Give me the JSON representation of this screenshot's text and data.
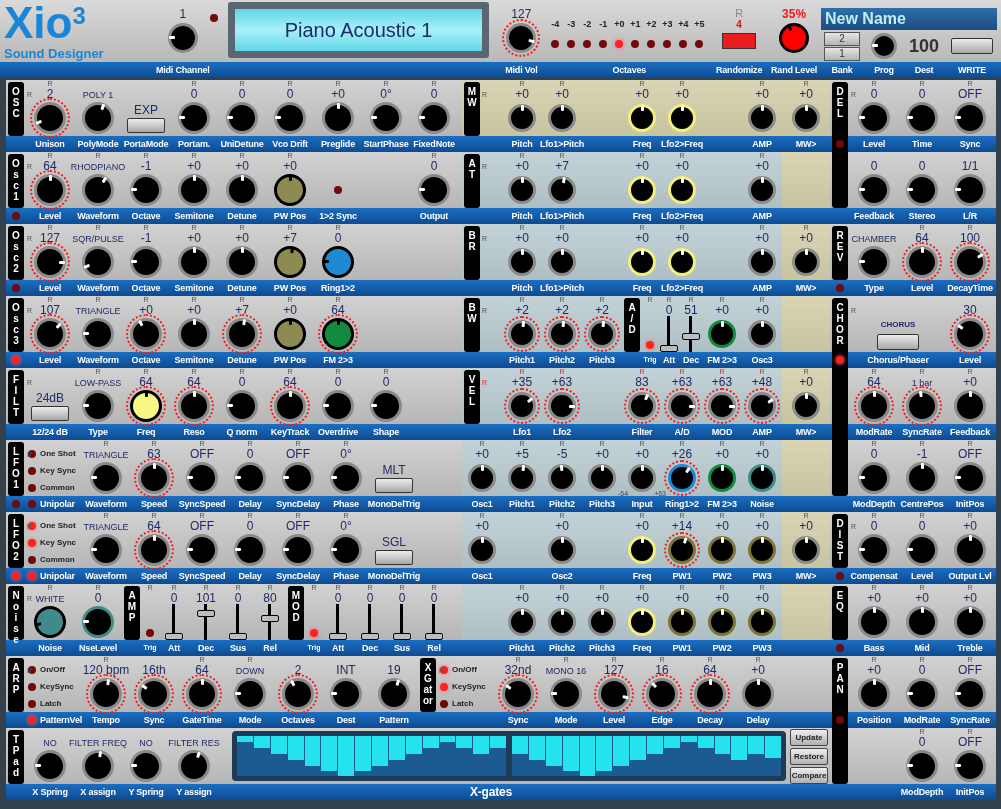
{
  "header": {
    "logo": {
      "title": "Xio$^{3}$",
      "subtitle": "Sound Designer"
    },
    "midi_channel": {
      "value": "1",
      "level": 0.1,
      "led": false,
      "label": "Midi Channel"
    },
    "display": "Piano Acoustic 1",
    "midi_vol": {
      "value": "127",
      "level": 0.85,
      "arc": true,
      "label": "Midi Vol"
    },
    "octaves": {
      "label": "Octaves",
      "items": [
        {
          "label": "-4",
          "selected": false
        },
        {
          "label": "-3",
          "selected": false
        },
        {
          "label": "-2",
          "selected": false
        },
        {
          "label": "-1",
          "selected": false
        },
        {
          "label": "+0",
          "selected": true
        },
        {
          "label": "+1",
          "selected": false
        },
        {
          "label": "+2",
          "selected": false
        },
        {
          "label": "+3",
          "selected": false
        },
        {
          "label": "+4",
          "selected": false
        },
        {
          "label": "+5",
          "selected": false
        }
      ]
    },
    "randomize": {
      "r": "R",
      "count": "4",
      "label": "Randomize"
    },
    "rand_level": {
      "kind": "knob_filled",
      "value": "35%",
      "level": 0.35,
      "color": "#ff0000",
      "label": "Rand Level"
    },
    "name": "New Name",
    "bank": {
      "buttons": [
        "2",
        "1"
      ],
      "label": "Bank"
    },
    "prog": {
      "level": 0.1,
      "label": "Prog"
    },
    "dest": {
      "value": "100",
      "label": "Dest"
    },
    "write": {
      "label": "WRITE"
    }
  },
  "left": [
    {
      "tag": [
        "O",
        "S",
        "C"
      ],
      "r": "R",
      "rand": false,
      "rows": [
        [
          {
            "kind": "knob",
            "r": "R",
            "value": "2",
            "label": "Unison",
            "level": 0.17,
            "arc": true
          },
          {
            "kind": "selector",
            "value": "POLY 1",
            "label": "PolyMode",
            "level": 0.63
          },
          {
            "kind": "button",
            "value": "EXP",
            "label": "PortaMode"
          },
          {
            "kind": "knob",
            "r": "R",
            "value": "0",
            "label": "Portam.",
            "level": 0.05
          },
          {
            "kind": "knob",
            "r": "R",
            "value": "0",
            "label": "UniDetune",
            "level": 0.05
          },
          {
            "kind": "knob",
            "r": "R",
            "value": "0",
            "label": "Vco Drift",
            "level": 0.05
          },
          {
            "kind": "knob",
            "r": "R",
            "value": "+0",
            "label": "Preglide",
            "level": 0.5
          },
          {
            "kind": "knob",
            "r": "R",
            "value": "0°",
            "label": "StartPhase",
            "level": 0.05
          },
          {
            "kind": "knob",
            "r": "R",
            "value": "0",
            "label": "FixedNote",
            "level": 0.05
          }
        ]
      ]
    },
    {
      "tag": [
        "O",
        "s",
        "c",
        "1"
      ],
      "r": "R",
      "rand": false,
      "led": false,
      "rows": [
        [
          {
            "kind": "knob",
            "r": "R",
            "value": "64",
            "label": "Level",
            "level": 0.5,
            "arc": true
          },
          {
            "kind": "selector",
            "r": "R",
            "value": "RHODPIANO",
            "label": "Waveform",
            "level": 0.68
          },
          {
            "kind": "knob",
            "r": "R",
            "value": "-1",
            "label": "Octave",
            "level": 0.1
          },
          {
            "kind": "knob",
            "r": "R",
            "value": "+0",
            "label": "Semitone",
            "level": 0.5
          },
          {
            "kind": "knob",
            "r": "R",
            "value": "+0",
            "label": "Detune",
            "level": 0.5
          },
          {
            "kind": "knob_filled",
            "r": "R",
            "value": "+0",
            "label": "PW Pos",
            "level": 0.5,
            "color": "#8d8a52"
          },
          {
            "kind": "led",
            "label": "1>2 Sync",
            "on": false
          },
          {
            "kind": "empty"
          },
          {
            "kind": "knob",
            "r": "R",
            "value": "0",
            "label": "Output",
            "level": 0.05
          }
        ]
      ]
    },
    {
      "tag": [
        "O",
        "s",
        "c",
        "2"
      ],
      "r": "R",
      "rand": false,
      "led": false,
      "rows": [
        [
          {
            "kind": "knob",
            "r": "R",
            "value": "127",
            "label": "Level",
            "level": 0.88,
            "arc": true
          },
          {
            "kind": "selector",
            "r": "R",
            "value": "SQR/PULSE",
            "label": "Waveform",
            "level": 0.17
          },
          {
            "kind": "knob",
            "r": "R",
            "value": "-1",
            "label": "Octave",
            "level": 0.1
          },
          {
            "kind": "knob",
            "r": "R",
            "value": "+0",
            "label": "Semitone",
            "level": 0.5
          },
          {
            "kind": "knob",
            "r": "R",
            "value": "+0",
            "label": "Detune",
            "level": 0.5
          },
          {
            "kind": "knob_filled",
            "r": "R",
            "value": "+7",
            "label": "PW Pos",
            "level": 0.55,
            "color": "#8d8a52"
          },
          {
            "kind": "knob_filled",
            "r": "R",
            "value": "0",
            "label": "Ring1>2",
            "level": 0.08,
            "color": "#1e8ad2"
          }
        ]
      ]
    },
    {
      "tag": [
        "O",
        "s",
        "c",
        "3"
      ],
      "r": "R",
      "rand": false,
      "led": true,
      "rows": [
        [
          {
            "kind": "knob",
            "r": "R",
            "value": "107",
            "label": "Level",
            "level": 0.75,
            "arc": true
          },
          {
            "kind": "selector",
            "r": "R",
            "value": "TRIANGLE",
            "label": "Waveform",
            "level": 0.12
          },
          {
            "kind": "knob",
            "r": "R",
            "value": "+0",
            "label": "Octave",
            "level": 0.33,
            "arc": true
          },
          {
            "kind": "knob",
            "r": "R",
            "value": "+0",
            "label": "Semitone",
            "level": 0.5
          },
          {
            "kind": "knob",
            "r": "R",
            "value": "+7",
            "label": "Detune",
            "level": 0.55,
            "arc": true
          },
          {
            "kind": "knob_filled",
            "r": "R",
            "value": "+0",
            "label": "PW Pos",
            "level": 0.5,
            "color": "#8d8a52"
          },
          {
            "kind": "knob_filled",
            "r": "R",
            "value": "64",
            "label": "FM 2>3",
            "level": 0.5,
            "color": "#138a40",
            "arc": true
          }
        ]
      ]
    },
    {
      "tag": [
        "F",
        "I",
        "L",
        "T"
      ],
      "r": "R",
      "rand": false,
      "rows": [
        [
          {
            "kind": "button",
            "value": "24dB",
            "label": "12/24 dB"
          },
          {
            "kind": "selector",
            "r": "R",
            "value": "LOW-PASS",
            "label": "Type",
            "level": 0.08
          },
          {
            "kind": "knob_filled",
            "r": "R",
            "value": "64",
            "label": "Freq",
            "level": 0.5,
            "color": "#f8f887",
            "arc": true
          },
          {
            "kind": "knob",
            "r": "R",
            "value": "64",
            "label": "Reso",
            "level": 0.5,
            "arc": true
          },
          {
            "kind": "knob",
            "r": "R",
            "value": "0",
            "label": "Q norm",
            "level": 0.05
          },
          {
            "kind": "knob",
            "r": "R",
            "value": "64",
            "label": "KeyTrack",
            "level": 0.5,
            "arc": true
          },
          {
            "kind": "knob",
            "r": "R",
            "value": "0",
            "label": "Overdrive",
            "level": 0.05
          },
          {
            "kind": "knob",
            "r": "R",
            "value": "0",
            "label": "Shape",
            "level": 0.05
          }
        ]
      ]
    },
    {
      "tag": [
        "L",
        "F",
        "O",
        "1"
      ],
      "r": "R",
      "rand": false,
      "led": false,
      "rows": [
        [
          {
            "kind": "leds",
            "items": [
              {
                "label": "One Shot",
                "on": false
              },
              {
                "label": "Key Sync",
                "on": false
              },
              {
                "label": "Common",
                "on": false
              }
            ],
            "label": "Unipolar",
            "label_led": false
          },
          {
            "kind": "selector",
            "r": "R",
            "value": "TRIANGLE",
            "label": "Waveform",
            "level": 0.12
          },
          {
            "kind": "knob",
            "r": "R",
            "value": "63",
            "label": "Speed",
            "level": 0.5,
            "arc": true
          },
          {
            "kind": "knob",
            "r": "R",
            "value": "OFF",
            "label": "SyncSpeed",
            "level": 0.05
          },
          {
            "kind": "knob",
            "r": "R",
            "value": "0",
            "label": "Delay",
            "level": 0.05
          },
          {
            "kind": "knob",
            "r": "R",
            "value": "OFF",
            "label": "SyncDelay",
            "level": 0.05
          },
          {
            "kind": "knob",
            "r": "R",
            "value": "0°",
            "label": "Phase",
            "level": 0.05
          },
          {
            "kind": "button",
            "value": "MLT",
            "label": "MonoDelTrig"
          }
        ]
      ]
    },
    {
      "tag": [
        "L",
        "F",
        "O",
        "2"
      ],
      "r": "R",
      "rand": false,
      "led": true,
      "rows": [
        [
          {
            "kind": "leds",
            "items": [
              {
                "label": "One Shot",
                "on": true
              },
              {
                "label": "Key Sync",
                "on": true
              },
              {
                "label": "Common",
                "on": false
              }
            ],
            "label": "Unipolar",
            "label_led": true
          },
          {
            "kind": "selector",
            "r": "R",
            "value": "TRIANGLE",
            "label": "Waveform",
            "level": 0.12
          },
          {
            "kind": "knob",
            "r": "R",
            "value": "64",
            "label": "Speed",
            "level": 0.5,
            "arc": true
          },
          {
            "kind": "knob",
            "r": "R",
            "value": "OFF",
            "label": "SyncSpeed",
            "level": 0.05
          },
          {
            "kind": "knob",
            "r": "R",
            "value": "0",
            "label": "Delay",
            "level": 0.05
          },
          {
            "kind": "knob",
            "r": "R",
            "value": "OFF",
            "label": "SyncDelay",
            "level": 0.05
          },
          {
            "kind": "knob",
            "r": "R",
            "value": "0°",
            "label": "Phase",
            "level": 0.05
          },
          {
            "kind": "button",
            "value": "SGL",
            "label": "MonoDelTrig"
          }
        ]
      ]
    },
    {
      "tag": [
        "N",
        "o",
        "i",
        "s",
        "e"
      ],
      "r": "R",
      "rand": false,
      "rows": [
        [
          {
            "kind": "selector_filled",
            "r": "R",
            "value": "WHITE",
            "label": "Noise",
            "level": 0.15,
            "color": "#3f8b8b"
          },
          {
            "kind": "knob_ringed",
            "r": "R",
            "value": "0",
            "label": "NseLevel",
            "level": 0.08,
            "color": "#3f8b8b"
          },
          {
            "kind": "tag",
            "lines": [
              "A",
              "M",
              "P"
            ]
          },
          {
            "kind": "trig",
            "r": "R",
            "label": "Trig",
            "on": false
          },
          {
            "kind": "slider",
            "r": "R",
            "value": "0",
            "label": "Att",
            "level": 0
          },
          {
            "kind": "slider",
            "r": "R",
            "value": "101",
            "label": "Dec",
            "level": 0.8
          },
          {
            "kind": "slider",
            "r": "R",
            "value": "0",
            "label": "Sus",
            "level": 0
          },
          {
            "kind": "slider",
            "r": "R",
            "value": "80",
            "label": "Rel",
            "level": 0.63
          },
          {
            "kind": "tag",
            "lines": [
              "M",
              "O",
              "D"
            ]
          },
          {
            "kind": "trig",
            "r": "R",
            "label": "Trig",
            "on": true
          },
          {
            "kind": "slider",
            "r": "R",
            "value": "0",
            "label": "Att",
            "level": 0
          },
          {
            "kind": "slider",
            "r": "R",
            "value": "0",
            "label": "Dec",
            "level": 0
          },
          {
            "kind": "slider",
            "r": "R",
            "value": "0",
            "label": "Sus",
            "level": 0
          },
          {
            "kind": "slider",
            "r": "R",
            "value": "0",
            "label": "Rel",
            "level": 0
          }
        ]
      ]
    }
  ],
  "middle": [
    {
      "tag": [
        "M",
        "W"
      ],
      "r": "R",
      "rand": false,
      "tinted": true,
      "rows": [
        [
          {
            "kind": "knob",
            "r": "R",
            "value": "+0",
            "label": "Pitch",
            "level": 0.5
          },
          {
            "kind": "knob",
            "r": "R",
            "value": "+0",
            "label": "Lfo1>Pitch",
            "level": 0.5
          },
          {
            "kind": "empty"
          },
          {
            "kind": "knob_ringed",
            "r": "R",
            "value": "+0",
            "label": "Freq",
            "level": 0.5,
            "color": "#f2ee7c"
          },
          {
            "kind": "knob_ringed",
            "r": "R",
            "value": "+0",
            "label": "Lfo2>Freq",
            "level": 0.5,
            "color": "#f2ee7c"
          },
          {
            "kind": "empty"
          },
          {
            "kind": "knob",
            "r": "R",
            "value": "+0",
            "label": "AMP",
            "level": 0.5
          }
        ]
      ],
      "mw": {
        "kind": "knob",
        "r": "R",
        "value": "+0",
        "label": "MW>",
        "level": 0.5
      }
    },
    {
      "tag": [
        "A",
        "T"
      ],
      "r": "R",
      "rand": false,
      "tinted": false,
      "rows": [
        [
          {
            "kind": "knob",
            "r": "R",
            "value": "+0",
            "label": "Pitch",
            "level": 0.5
          },
          {
            "kind": "knob",
            "r": "R",
            "value": "+7",
            "label": "Lfo1>Pitch",
            "level": 0.55
          },
          {
            "kind": "empty"
          },
          {
            "kind": "knob_ringed",
            "r": "R",
            "value": "+0",
            "label": "Freq",
            "level": 0.5,
            "color": "#f2ee7c"
          },
          {
            "kind": "knob_ringed",
            "r": "R",
            "value": "+0",
            "label": "Lfo2>Freq",
            "level": 0.5,
            "color": "#f2ee7c"
          },
          {
            "kind": "empty"
          },
          {
            "kind": "knob",
            "r": "R",
            "value": "+0",
            "label": "AMP",
            "level": 0.5
          }
        ]
      ]
    },
    {
      "tag": [
        "B",
        "R"
      ],
      "r": "R",
      "rand": false,
      "tinted": false,
      "rows": [
        [
          {
            "kind": "knob",
            "r": "R",
            "value": "+0",
            "label": "Pitch",
            "level": 0.5
          },
          {
            "kind": "knob",
            "r": "R",
            "value": "+0",
            "label": "Lfo1>Pitch",
            "level": 0.5
          },
          {
            "kind": "empty"
          },
          {
            "kind": "knob_ringed",
            "r": "R",
            "value": "+0",
            "label": "Freq",
            "level": 0.5,
            "color": "#f2ee7c"
          },
          {
            "kind": "knob_ringed",
            "r": "R",
            "value": "+0",
            "label": "Lfo2>Freq",
            "level": 0.5,
            "color": "#f2ee7c"
          },
          {
            "kind": "empty"
          },
          {
            "kind": "knob",
            "r": "R",
            "value": "+0",
            "label": "AMP",
            "level": 0.5
          }
        ]
      ],
      "mw": {
        "kind": "knob",
        "r": "R",
        "value": "+0",
        "label": "MW>",
        "level": 0.5
      }
    },
    {
      "tag": [
        "B",
        "W"
      ],
      "r": "R",
      "rand": false,
      "tinted": false,
      "rows": [
        [
          {
            "kind": "knob",
            "r": "R",
            "value": "+2",
            "label": "Pitch1",
            "level": 0.53,
            "arc": true
          },
          {
            "kind": "knob",
            "r": "R",
            "value": "+2",
            "label": "Pitch2",
            "level": 0.53,
            "arc": true
          },
          {
            "kind": "knob",
            "r": "R",
            "value": "+2",
            "label": "Pitch3",
            "level": 0.53,
            "arc": true
          },
          {
            "kind": "tag",
            "lines": [
              "A",
              "/",
              "D"
            ]
          },
          {
            "kind": "trig",
            "r": "R",
            "label": "Trig",
            "on": true
          },
          {
            "kind": "slider",
            "r": "R",
            "value": "0",
            "label": "Att",
            "level": 0
          },
          {
            "kind": "slider",
            "r": "R",
            "value": "51",
            "label": "Dec",
            "level": 0.4
          },
          {
            "kind": "knob_ringed",
            "r": "R",
            "value": "+0",
            "label": "FM 2>3",
            "level": 0.5,
            "color": "#138a40"
          },
          {
            "kind": "knob",
            "r": "R",
            "value": "+0",
            "label": "Osc3",
            "level": 0.5
          }
        ]
      ]
    },
    {
      "tag": [
        "V",
        "E",
        "L"
      ],
      "r": "R",
      "rand": true,
      "tinted": false,
      "rows": [
        [
          {
            "kind": "knob",
            "r": "R",
            "value": "+35",
            "label": "Lfo1",
            "level": 0.78,
            "arc": true
          },
          {
            "kind": "knob",
            "r": "R",
            "value": "+63",
            "label": "Lfo2",
            "level": 0.88,
            "arc": true
          },
          {
            "kind": "empty"
          },
          {
            "kind": "knob",
            "r": "R",
            "value": "83",
            "label": "Filter",
            "level": 0.65,
            "arc": true
          },
          {
            "kind": "knob",
            "r": "R",
            "value": "+63",
            "label": "A/D",
            "level": 0.88,
            "arc": true
          },
          {
            "kind": "knob",
            "r": "R",
            "value": "+63",
            "label": "MOD",
            "level": 0.88,
            "arc": true
          },
          {
            "kind": "knob",
            "r": "R",
            "value": "+48",
            "label": "AMP",
            "level": 0.8,
            "arc": true
          }
        ]
      ],
      "mw": {
        "kind": "knob",
        "r": "R",
        "value": "+0",
        "label": "MW>",
        "level": 0.5
      }
    },
    {
      "rand": false,
      "tinted": false,
      "rows": [
        [
          {
            "kind": "knob",
            "r": "R",
            "value": "+0",
            "label": "Osc1",
            "level": 0.5
          },
          {
            "kind": "knob",
            "r": "R",
            "value": "+5",
            "label": "Pitch1",
            "level": 0.53
          },
          {
            "kind": "knob",
            "r": "R",
            "value": "-5",
            "label": "Pitch2",
            "level": 0.47
          },
          {
            "kind": "knob",
            "r": "R",
            "value": "+0",
            "label": "Pitch3",
            "level": 0.5
          },
          {
            "kind": "knob",
            "r": "R",
            "value": "+0",
            "label": "Input",
            "level": 0.5,
            "min": "-64",
            "max": "+63"
          },
          {
            "kind": "knob_ringed",
            "r": "R",
            "value": "+26",
            "label": "Ring1>2",
            "level": 0.7,
            "color": "#1e8ad2",
            "arc": true
          },
          {
            "kind": "knob_ringed",
            "r": "R",
            "value": "+0",
            "label": "FM 2>3",
            "level": 0.5,
            "color": "#138a40"
          },
          {
            "kind": "knob_ringed",
            "r": "R",
            "value": "+0",
            "label": "Noise",
            "level": 0.5,
            "color": "#3f8b8b"
          }
        ]
      ]
    },
    {
      "rand": false,
      "tinted": false,
      "rows": [
        [
          {
            "kind": "knob",
            "r": "R",
            "value": "+0",
            "label": "Osc1",
            "level": 0.5
          },
          {
            "kind": "empty"
          },
          {
            "kind": "knob",
            "r": "R",
            "value": "+0",
            "label": "Osc2",
            "level": 0.5
          },
          {
            "kind": "empty"
          },
          {
            "kind": "knob_ringed",
            "r": "R",
            "value": "+0",
            "label": "Freq",
            "level": 0.5,
            "color": "#f2ee7c"
          },
          {
            "kind": "knob_ringed",
            "r": "R",
            "value": "+14",
            "label": "PW1",
            "level": 0.6,
            "color": "#7d7637",
            "arc": true
          },
          {
            "kind": "knob_ringed",
            "r": "R",
            "value": "+0",
            "label": "PW2",
            "level": 0.5,
            "color": "#7d7637"
          },
          {
            "kind": "knob_ringed",
            "r": "R",
            "value": "+0",
            "label": "PW3",
            "level": 0.5,
            "color": "#7d7637"
          }
        ]
      ],
      "mw": {
        "kind": "knob",
        "r": "R",
        "value": "+0",
        "label": "MW>",
        "level": 0.5
      }
    },
    {
      "rand": false,
      "tinted": false,
      "rows": [
        [
          {
            "kind": "empty"
          },
          {
            "kind": "knob",
            "r": "R",
            "value": "+0",
            "label": "Pitch1",
            "level": 0.5
          },
          {
            "kind": "knob",
            "r": "R",
            "value": "+0",
            "label": "Pitch2",
            "level": 0.5
          },
          {
            "kind": "knob",
            "r": "R",
            "value": "+0",
            "label": "Pitch3",
            "level": 0.5
          },
          {
            "kind": "knob_ringed",
            "r": "R",
            "value": "+0",
            "label": "Freq",
            "level": 0.5,
            "color": "#f2ee7c"
          },
          {
            "kind": "knob_ringed",
            "r": "R",
            "value": "+0",
            "label": "PW1",
            "level": 0.5,
            "color": "#7d7637"
          },
          {
            "kind": "knob_ringed",
            "r": "R",
            "value": "+0",
            "label": "PW2",
            "level": 0.5,
            "color": "#7d7637"
          },
          {
            "kind": "knob_ringed",
            "r": "R",
            "value": "+0",
            "label": "PW3",
            "level": 0.5,
            "color": "#7d7637"
          }
        ]
      ]
    }
  ],
  "arp_row": [
    {
      "tag": [
        "A",
        "R",
        "P"
      ],
      "r": "R",
      "rand": false,
      "rows": [
        [
          {
            "kind": "leds",
            "items": [
              {
                "label": "On/Off",
                "on": false
              },
              {
                "label": "KeySync",
                "on": false
              },
              {
                "label": "Latch",
                "on": false
              }
            ],
            "label": "PatternVel",
            "label_led": true
          },
          {
            "kind": "knob",
            "r": "R",
            "value": "120 bpm",
            "label": "Tempo",
            "level": 0.55,
            "arc": true
          },
          {
            "kind": "knob",
            "value": "16th",
            "label": "Sync",
            "level": 0.2,
            "arc": true
          },
          {
            "kind": "knob",
            "r": "R",
            "value": "64",
            "label": "GateTime",
            "level": 0.5,
            "arc": true
          },
          {
            "kind": "selector",
            "r": "R",
            "value": "DOWN",
            "label": "Mode",
            "level": 0.08
          },
          {
            "kind": "knob",
            "value": "2",
            "label": "Octaves",
            "level": 0.33,
            "arc": true
          },
          {
            "kind": "knob",
            "value": "INT",
            "label": "Dest",
            "level": 0.08
          },
          {
            "kind": "knob",
            "value": "19",
            "label": "Pattern",
            "level": 0.6
          }
        ]
      ]
    },
    {
      "tag": [
        "X",
        "G",
        "at",
        "or"
      ],
      "r": "R",
      "rand": false,
      "rows": [
        [
          {
            "kind": "leds",
            "items": [
              {
                "label": "On/Off",
                "on": true
              },
              {
                "label": "KeySync",
                "on": true
              },
              {
                "label": "Latch",
                "on": false
              }
            ]
          },
          {
            "kind": "knob",
            "r": "R",
            "value": "32nd",
            "label": "Sync",
            "level": 0.2,
            "arc": true
          },
          {
            "kind": "selector",
            "r": "R",
            "value": "MONO 16",
            "label": "Mode",
            "level": 0.1
          },
          {
            "kind": "knob",
            "r": "R",
            "value": "127",
            "label": "Level",
            "level": 0.85,
            "arc": true
          },
          {
            "kind": "knob",
            "r": "R",
            "value": "16",
            "label": "Edge",
            "level": 0.25,
            "arc": true
          },
          {
            "kind": "knob",
            "r": "R",
            "value": "64",
            "label": "Decay",
            "level": 0.5,
            "arc": true
          },
          {
            "kind": "knob",
            "r": "R",
            "value": "+0",
            "label": "Delay",
            "level": 0.5
          }
        ]
      ]
    }
  ],
  "tpad_row": {
    "panel": {
      "tag": [
        "T",
        "P",
        "a",
        "d"
      ],
      "rows": [
        [
          {
            "kind": "selector",
            "value": "NO",
            "label": "X Spring",
            "level": 0.08
          },
          {
            "kind": "selector",
            "value": "FILTER FREQ",
            "label": "X assign",
            "level": 0.55
          },
          {
            "kind": "selector",
            "value": "NO",
            "label": "Y Spring",
            "level": 0.08
          },
          {
            "kind": "selector",
            "value": "FILTER RES",
            "label": "Y assign",
            "level": 0.62
          }
        ]
      ]
    },
    "xgates": {
      "label": "X-gates"
    },
    "buttons": [
      "Update",
      "Restore",
      "Compare"
    ]
  },
  "right": [
    {
      "tag": [
        "D",
        "E",
        "L"
      ],
      "r": "R",
      "rand": false,
      "led": false,
      "rows": [
        [
          {
            "kind": "knob",
            "r": "R",
            "value": "0",
            "label": "Level",
            "level": 0.05
          },
          {
            "kind": "knob",
            "r": "R",
            "value": "0",
            "label": "Time",
            "level": 0.05
          },
          {
            "kind": "knob",
            "r": "R",
            "value": "OFF",
            "label": "Sync",
            "level": 0.05
          }
        ],
        [
          {
            "kind": "knob",
            "value": "0",
            "label": "Feedback",
            "level": 0.05
          },
          {
            "kind": "knob",
            "value": "0",
            "label": "Stereo",
            "level": 0.05
          },
          {
            "kind": "knob",
            "value": "1/1",
            "label": "L/R",
            "level": 0.05
          }
        ]
      ]
    },
    {
      "tag": [
        "R",
        "E",
        "V"
      ],
      "rand": false,
      "led": false,
      "rows": [
        [
          {
            "kind": "selector",
            "value": "CHAMBER",
            "label": "Type",
            "level": 0.08
          },
          {
            "kind": "knob",
            "r": "R",
            "value": "64",
            "label": "Level",
            "level": 0.5,
            "arc": true
          },
          {
            "kind": "knob",
            "r": "R",
            "value": "100",
            "label": "DecayTime",
            "level": 0.8,
            "arc": true
          }
        ]
      ]
    },
    {
      "tag": [
        "C",
        "H",
        "O",
        "R"
      ],
      "r": "R",
      "rand": false,
      "led": true,
      "rows": [
        [
          {
            "kind": "wide_button",
            "value": "CHORUS",
            "label": "Chorus/Phaser"
          },
          {
            "kind": "covered"
          },
          {
            "kind": "knob",
            "value": "30",
            "label": "Level",
            "level": 0.2,
            "arc": true
          }
        ],
        [
          {
            "kind": "knob",
            "r": "R",
            "value": "64",
            "label": "ModRate",
            "level": 0.5,
            "arc": true
          },
          {
            "kind": "selector",
            "r": "R",
            "value": "1 bar",
            "label": "SyncRate",
            "level": 0.45,
            "arc": true
          },
          {
            "kind": "knob",
            "r": "R",
            "value": "+0",
            "label": "Feedback",
            "level": 0.5
          }
        ],
        [
          {
            "kind": "knob",
            "r": "R",
            "value": "0",
            "label": "ModDepth",
            "level": 0.05
          },
          {
            "kind": "knob",
            "r": "R",
            "value": "-1",
            "label": "CentrePos",
            "level": 0.5
          },
          {
            "kind": "knob",
            "r": "R",
            "value": "OFF",
            "label": "InitPos",
            "level": 0.05
          }
        ]
      ]
    },
    {
      "tag": [
        "D",
        "I",
        "S",
        "T"
      ],
      "r": "R",
      "rand": false,
      "led": false,
      "rows": [
        [
          {
            "kind": "knob",
            "r": "R",
            "value": "0",
            "label": "Compensat",
            "level": 0.05
          },
          {
            "kind": "knob",
            "r": "R",
            "value": "0",
            "label": "Level",
            "level": 0.05
          },
          {
            "kind": "knob",
            "r": "R",
            "value": "+0",
            "label": "Output Lvl",
            "level": 0.5
          }
        ]
      ]
    },
    {
      "tag": [
        "E",
        "Q"
      ],
      "rand": false,
      "led": false,
      "rows": [
        [
          {
            "kind": "knob",
            "r": "R",
            "value": "+0",
            "label": "Bass",
            "level": 0.5
          },
          {
            "kind": "knob",
            "r": "R",
            "value": "+0",
            "label": "Mid",
            "level": 0.5
          },
          {
            "kind": "knob",
            "r": "R",
            "value": "+0",
            "label": "Treble",
            "level": 0.5
          }
        ]
      ]
    },
    {
      "tag": [
        "P",
        "A",
        "N"
      ],
      "rand": false,
      "led": false,
      "rows": [
        [
          {
            "kind": "knob",
            "r": "R",
            "value": "+0",
            "label": "Position",
            "level": 0.5
          },
          {
            "kind": "knob",
            "r": "R",
            "value": "0",
            "label": "ModRate",
            "level": 0.05
          },
          {
            "kind": "knob",
            "r": "R",
            "value": "OFF",
            "label": "SyncRate",
            "level": 0.05
          }
        ],
        [
          {
            "kind": "empty"
          },
          {
            "kind": "knob",
            "r": "R",
            "value": "0",
            "label": "ModDepth",
            "level": 0.05
          },
          {
            "kind": "knob",
            "r": "R",
            "value": "OFF",
            "label": "InitPos",
            "level": 0.05
          }
        ]
      ]
    }
  ]
}
